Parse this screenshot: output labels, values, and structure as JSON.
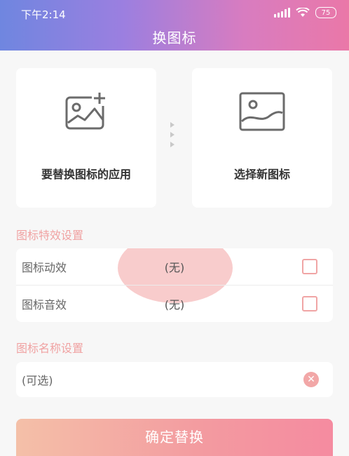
{
  "status": {
    "time": "下午2:14",
    "battery": "75"
  },
  "header": {
    "title": "换图标"
  },
  "cards": {
    "left": {
      "label": "要替换图标的应用",
      "icon": "image-add-icon"
    },
    "right": {
      "label": "选择新图标",
      "icon": "image-icon"
    }
  },
  "effects": {
    "title": "图标特效设置",
    "rows": [
      {
        "name": "图标动效",
        "value": "(无)"
      },
      {
        "name": "图标音效",
        "value": "(无)"
      }
    ]
  },
  "naming": {
    "title": "图标名称设置",
    "placeholder": "(可选)"
  },
  "confirm": {
    "label": "确定替换"
  },
  "colors": {
    "accent": "#f39aa0",
    "section_title": "#f0a2a2",
    "header_gradient_start": "#6f86e0",
    "header_gradient_end": "#ea78a8"
  }
}
